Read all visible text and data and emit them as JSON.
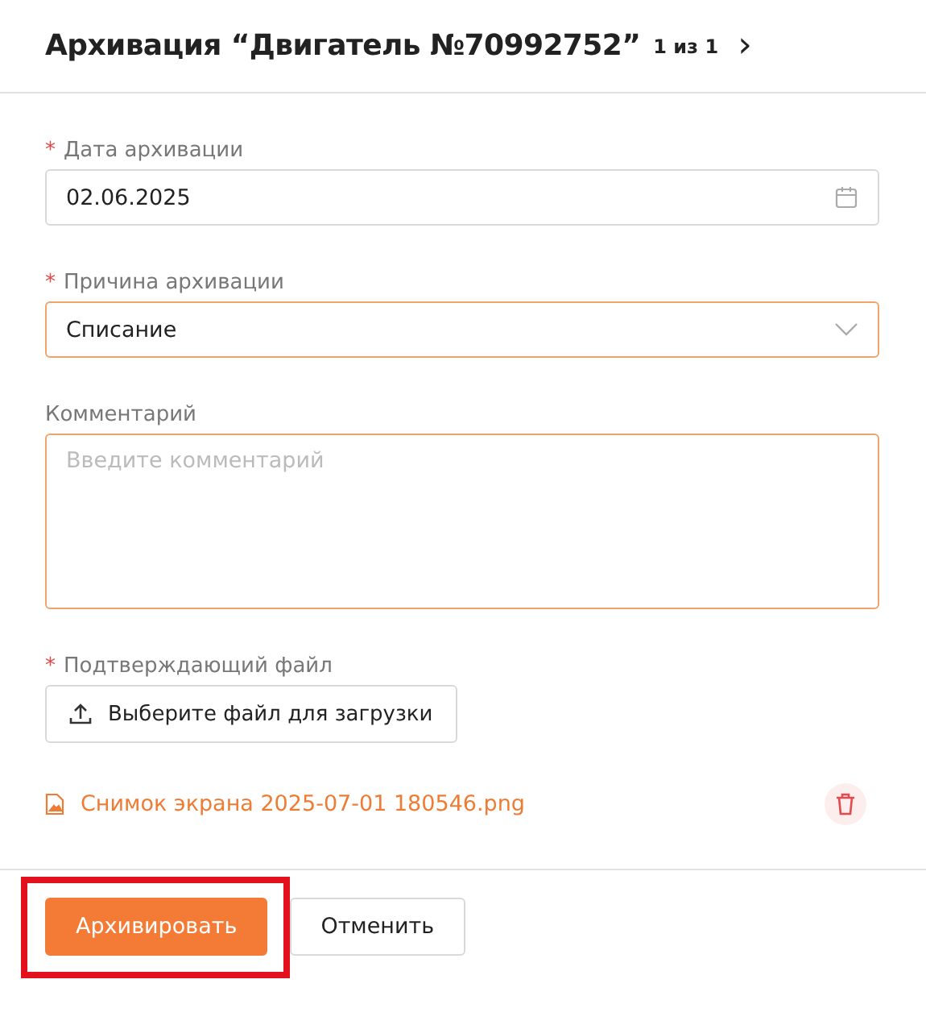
{
  "header": {
    "title": "Архивация “Двигатель №70992752”",
    "pager": "1 из 1",
    "next": "›"
  },
  "fields": [
    {
      "kind": "date",
      "label": "Дата архивации",
      "required_mark": "*",
      "highlighted": false,
      "value": "02.06.2025"
    },
    {
      "kind": "select",
      "label": "Причина архивации",
      "required_mark": "*",
      "highlighted": true,
      "value": "Списание"
    },
    {
      "kind": "textarea",
      "label": "Комментарий",
      "highlighted": true,
      "placeholder": "Введите комментарий"
    },
    {
      "kind": "upload",
      "label": "Подтверждающий файл",
      "required_mark": "*",
      "highlighted": false,
      "button": "Выберите файл для загрузки"
    }
  ],
  "attachments": [
    {
      "name": "Снимок экрана 2025-07-01 180546.png"
    }
  ],
  "buttons": [
    {
      "label": "Архивировать",
      "kind": "primary",
      "annotated": true
    },
    {
      "label": "Отменить",
      "kind": "secondary",
      "annotated": false
    }
  ]
}
